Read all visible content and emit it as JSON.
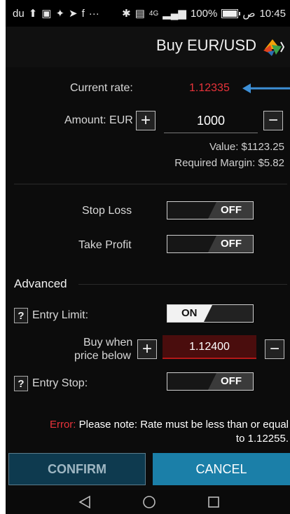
{
  "status_bar": {
    "left_text": "du",
    "time": "10:45",
    "time_suffix": "ص",
    "battery": "100%",
    "network": "4G"
  },
  "header": {
    "title": "Buy EUR/USD"
  },
  "rate": {
    "label": "Current rate:",
    "value": "1.12335"
  },
  "amount": {
    "label": "Amount: EUR",
    "value": "1000",
    "plus": "+",
    "minus": "−"
  },
  "summary": {
    "value_text": "Value: $1123.25",
    "margin_text": "Required Margin: $5.82"
  },
  "stop_loss": {
    "label": "Stop Loss",
    "state": "OFF"
  },
  "take_profit": {
    "label": "Take Profit",
    "state": "OFF"
  },
  "advanced": {
    "title": "Advanced"
  },
  "entry_limit": {
    "help": "?",
    "label": "Entry Limit:",
    "state": "ON"
  },
  "buy_when": {
    "label_line1": "Buy when",
    "label_line2": "price below",
    "value": "1.12400",
    "plus": "+",
    "minus": "−"
  },
  "entry_stop": {
    "help": "?",
    "label": "Entry Stop:",
    "state": "OFF"
  },
  "error": {
    "label": "Error:",
    "message_line1": "Please note: Rate must be less than or equal",
    "message_line2": "to 1.12255."
  },
  "buttons": {
    "confirm": "CONFIRM",
    "cancel": "CANCEL"
  },
  "colors": {
    "error_red": "#e8333a",
    "cancel_blue": "#1b7fa8",
    "confirm_teal": "#0e3a4f"
  }
}
